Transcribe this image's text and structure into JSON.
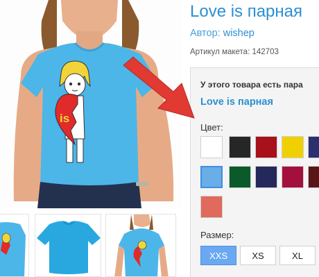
{
  "product": {
    "title": "Love is парная",
    "author_label": "Автор:",
    "author_name": "wishep",
    "article_label": "Артикул макета:",
    "article_number": "142703",
    "print_text": "is"
  },
  "options": {
    "pair_notice": "У этого товара есть пара",
    "pair_link": "Love is парная",
    "color_label": "Цвет:",
    "colors": [
      {
        "name": "white",
        "hex": "#ffffff"
      },
      {
        "name": "black",
        "hex": "#262626"
      },
      {
        "name": "red",
        "hex": "#a8101a"
      },
      {
        "name": "yellow",
        "hex": "#f0d000"
      },
      {
        "name": "navy",
        "hex": "#2b3070"
      },
      {
        "name": "sky-blue",
        "hex": "#6aaee8",
        "selected": true
      },
      {
        "name": "green",
        "hex": "#0a5a2a"
      },
      {
        "name": "dark-blue",
        "hex": "#25285a"
      },
      {
        "name": "crimson",
        "hex": "#a4103e"
      },
      {
        "name": "burgundy",
        "hex": "#5a1616"
      },
      {
        "name": "coral",
        "hex": "#e06a5c"
      }
    ],
    "size_label": "Размер:",
    "sizes": [
      {
        "label": "XXS",
        "selected": true
      },
      {
        "label": "XS",
        "selected": false
      },
      {
        "label": "XL",
        "selected": false
      }
    ]
  },
  "colors": {
    "link": "#2b8fd1",
    "shirt": "#4cb6e8",
    "arrow": "#e03a33"
  }
}
